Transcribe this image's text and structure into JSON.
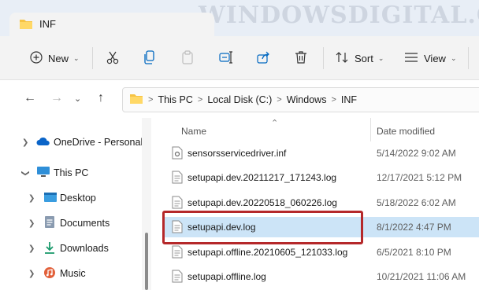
{
  "window": {
    "tab_title": "INF",
    "watermark": "WINDOWSDIGITAL.COM"
  },
  "toolbar": {
    "new_label": "New",
    "sort_label": "Sort",
    "view_label": "View",
    "more_label": "···"
  },
  "address": {
    "segments": [
      "This PC",
      "Local Disk (C:)",
      "Windows",
      "INF"
    ]
  },
  "sidebar": {
    "items": [
      {
        "label": "OneDrive - Personal",
        "icon": "cloud-icon"
      },
      {
        "label": "This PC",
        "icon": "monitor-icon"
      },
      {
        "label": "Desktop",
        "icon": "desktop-icon"
      },
      {
        "label": "Documents",
        "icon": "documents-icon"
      },
      {
        "label": "Downloads",
        "icon": "download-icon"
      },
      {
        "label": "Music",
        "icon": "music-icon"
      }
    ]
  },
  "files": {
    "columns": {
      "name": "Name",
      "date": "Date modified"
    },
    "rows": [
      {
        "name": "sensorsservicedriver.inf",
        "date": "5/14/2022 9:02 AM",
        "type": "settings-file-icon"
      },
      {
        "name": "setupapi.dev.20211217_171243.log",
        "date": "12/17/2021 5:12 PM",
        "type": "text-file-icon"
      },
      {
        "name": "setupapi.dev.20220518_060226.log",
        "date": "5/18/2022 6:02 AM",
        "type": "text-file-icon"
      },
      {
        "name": "setupapi.dev.log",
        "date": "8/1/2022 4:47 PM",
        "type": "text-file-icon",
        "selected": true
      },
      {
        "name": "setupapi.offline.20210605_121033.log",
        "date": "6/5/2021 8:10 PM",
        "type": "text-file-icon"
      },
      {
        "name": "setupapi.offline.log",
        "date": "10/21/2021 11:06 AM",
        "type": "text-file-icon"
      }
    ]
  },
  "colors": {
    "accent": "#0067c0",
    "selection": "#cce4f7",
    "highlight_box": "#b5282a",
    "folder": "#f6c343"
  }
}
